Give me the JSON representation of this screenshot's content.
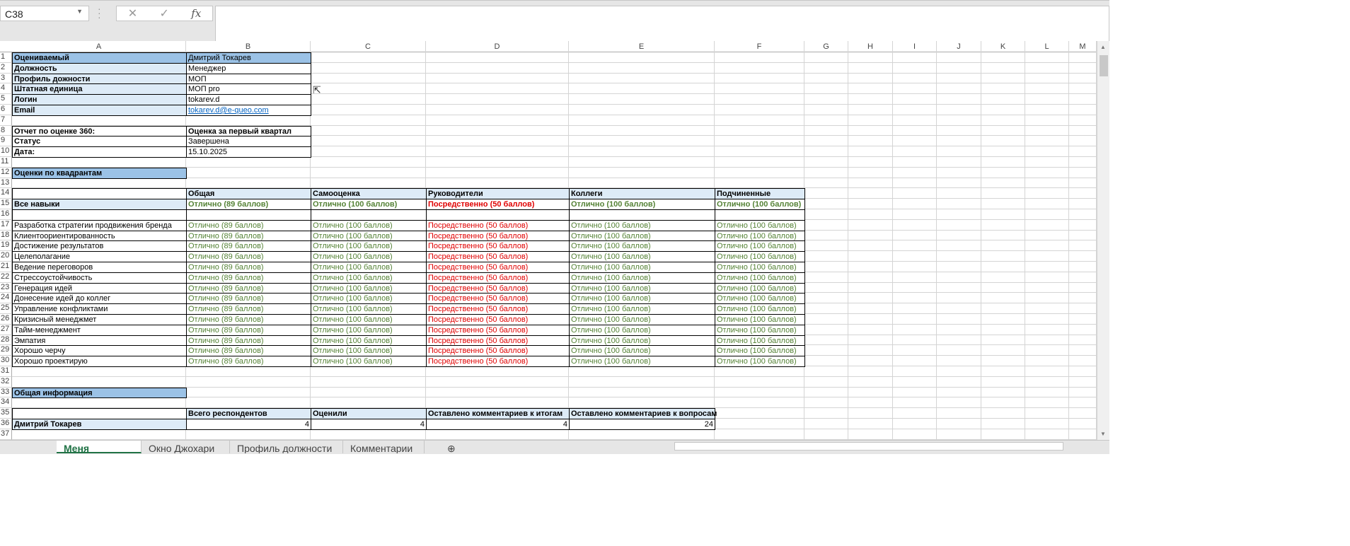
{
  "formula_bar": {
    "name_box": "C38",
    "cancel_icon": "✕",
    "enter_icon": "✓",
    "fx_label": "fx",
    "formula": ""
  },
  "columns": [
    "A",
    "B",
    "C",
    "D",
    "E",
    "F",
    "G",
    "H",
    "I",
    "J",
    "K",
    "L",
    "M"
  ],
  "rows": [
    [
      "Оцениваемый",
      "Дмитрий Токарев",
      "",
      "",
      "",
      ""
    ],
    [
      "Должность",
      "Менеджер",
      "",
      "",
      "",
      ""
    ],
    [
      "Профиль дожности",
      "МОП",
      "",
      "",
      "",
      ""
    ],
    [
      "Штатная единица",
      "МОП pro",
      "",
      "",
      "",
      ""
    ],
    [
      "Логин",
      "tokarev.d",
      "",
      "",
      "",
      ""
    ],
    [
      "Email",
      "tokarev.d@e-queo.com",
      "",
      "",
      "",
      ""
    ],
    [
      "",
      "",
      "",
      "",
      "",
      ""
    ],
    [
      "Отчет по оценке 360:",
      "Оценка за первый квартал",
      "",
      "",
      "",
      ""
    ],
    [
      "Статус",
      "Завершена",
      "",
      "",
      "",
      ""
    ],
    [
      "Дата:",
      "15.10.2025",
      "",
      "",
      "",
      ""
    ],
    [
      "",
      "",
      "",
      "",
      "",
      ""
    ],
    [
      "Оценки по квадрантам",
      "",
      "",
      "",
      "",
      ""
    ],
    [
      "",
      "",
      "",
      "",
      "",
      ""
    ],
    [
      "",
      "Общая",
      "Самооценка",
      "Руководители",
      "Коллеги",
      "Подчиненные"
    ],
    [
      "Все навыки",
      "Отлично (89 баллов)",
      "Отлично (100 баллов)",
      "Посредственно (50 баллов)",
      "Отлично (100 баллов)",
      "Отлично (100 баллов)"
    ],
    [
      "",
      "",
      "",
      "",
      "",
      ""
    ],
    [
      "Разработка стратегии продвижения бренда",
      "Отлично (89 баллов)",
      "Отлично (100 баллов)",
      "Посредственно (50 баллов)",
      "Отлично (100 баллов)",
      "Отлично (100 баллов)"
    ],
    [
      "Клиентоориентированность",
      "Отлично (89 баллов)",
      "Отлично (100 баллов)",
      "Посредственно (50 баллов)",
      "Отлично (100 баллов)",
      "Отлично (100 баллов)"
    ],
    [
      "Достижение результатов",
      "Отлично (89 баллов)",
      "Отлично (100 баллов)",
      "Посредственно (50 баллов)",
      "Отлично (100 баллов)",
      "Отлично (100 баллов)"
    ],
    [
      "Целеполагание",
      "Отлично (89 баллов)",
      "Отлично (100 баллов)",
      "Посредственно (50 баллов)",
      "Отлично (100 баллов)",
      "Отлично (100 баллов)"
    ],
    [
      "Ведение переговоров",
      "Отлично (89 баллов)",
      "Отлично (100 баллов)",
      "Посредственно (50 баллов)",
      "Отлично (100 баллов)",
      "Отлично (100 баллов)"
    ],
    [
      "Стрессоустойчивость",
      "Отлично (89 баллов)",
      "Отлично (100 баллов)",
      "Посредственно (50 баллов)",
      "Отлично (100 баллов)",
      "Отлично (100 баллов)"
    ],
    [
      "Генерация идей",
      "Отлично (89 баллов)",
      "Отлично (100 баллов)",
      "Посредственно (50 баллов)",
      "Отлично (100 баллов)",
      "Отлично (100 баллов)"
    ],
    [
      "Донесение идей до коллег",
      "Отлично (89 баллов)",
      "Отлично (100 баллов)",
      "Посредственно (50 баллов)",
      "Отлично (100 баллов)",
      "Отлично (100 баллов)"
    ],
    [
      "Управление конфликтами",
      "Отлично (89 баллов)",
      "Отлично (100 баллов)",
      "Посредственно (50 баллов)",
      "Отлично (100 баллов)",
      "Отлично (100 баллов)"
    ],
    [
      "Кризисный менеджмет",
      "Отлично (89 баллов)",
      "Отлично (100 баллов)",
      "Посредственно (50 баллов)",
      "Отлично (100 баллов)",
      "Отлично (100 баллов)"
    ],
    [
      "Тайм-менеджмент",
      "Отлично (89 баллов)",
      "Отлично (100 баллов)",
      "Посредственно (50 баллов)",
      "Отлично (100 баллов)",
      "Отлично (100 баллов)"
    ],
    [
      "Эмпатия",
      "Отлично (89 баллов)",
      "Отлично (100 баллов)",
      "Посредственно (50 баллов)",
      "Отлично (100 баллов)",
      "Отлично (100 баллов)"
    ],
    [
      "Хорошо черчу",
      "Отлично (89 баллов)",
      "Отлично (100 баллов)",
      "Посредственно (50 баллов)",
      "Отлично (100 баллов)",
      "Отлично (100 баллов)"
    ],
    [
      "Хорошо проектирую",
      "Отлично (89 баллов)",
      "Отлично (100 баллов)",
      "Посредственно (50 баллов)",
      "Отлично (100 баллов)",
      "Отлично (100 баллов)"
    ],
    [
      "",
      "",
      "",
      "",
      "",
      ""
    ],
    [
      "",
      "",
      "",
      "",
      "",
      ""
    ],
    [
      "Общая информация",
      "",
      "",
      "",
      "",
      ""
    ],
    [
      "",
      "",
      "",
      "",
      "",
      ""
    ],
    [
      "",
      "Всего респондентов",
      "Оценили",
      "Оставлено комментариев к итогам",
      "Оставлено комментариев к вопросам",
      ""
    ],
    [
      "Дмитрий Токарев",
      "4",
      "4",
      "4",
      "24",
      ""
    ],
    [
      "",
      "",
      "",
      "",
      "",
      ""
    ]
  ],
  "sheet_tabs": [
    {
      "label": "Меня оценили",
      "active": true
    },
    {
      "label": "Окно Джохари",
      "active": false
    },
    {
      "label": "Профиль должности",
      "active": false
    },
    {
      "label": "Комментарии",
      "active": false
    }
  ],
  "add_sheet_icon": "⊕",
  "colors": {
    "header_fill": "#9bc2e6",
    "light_fill": "#ddebf7",
    "good": "#548235",
    "bad": "#e00000",
    "accent": "#217346"
  }
}
